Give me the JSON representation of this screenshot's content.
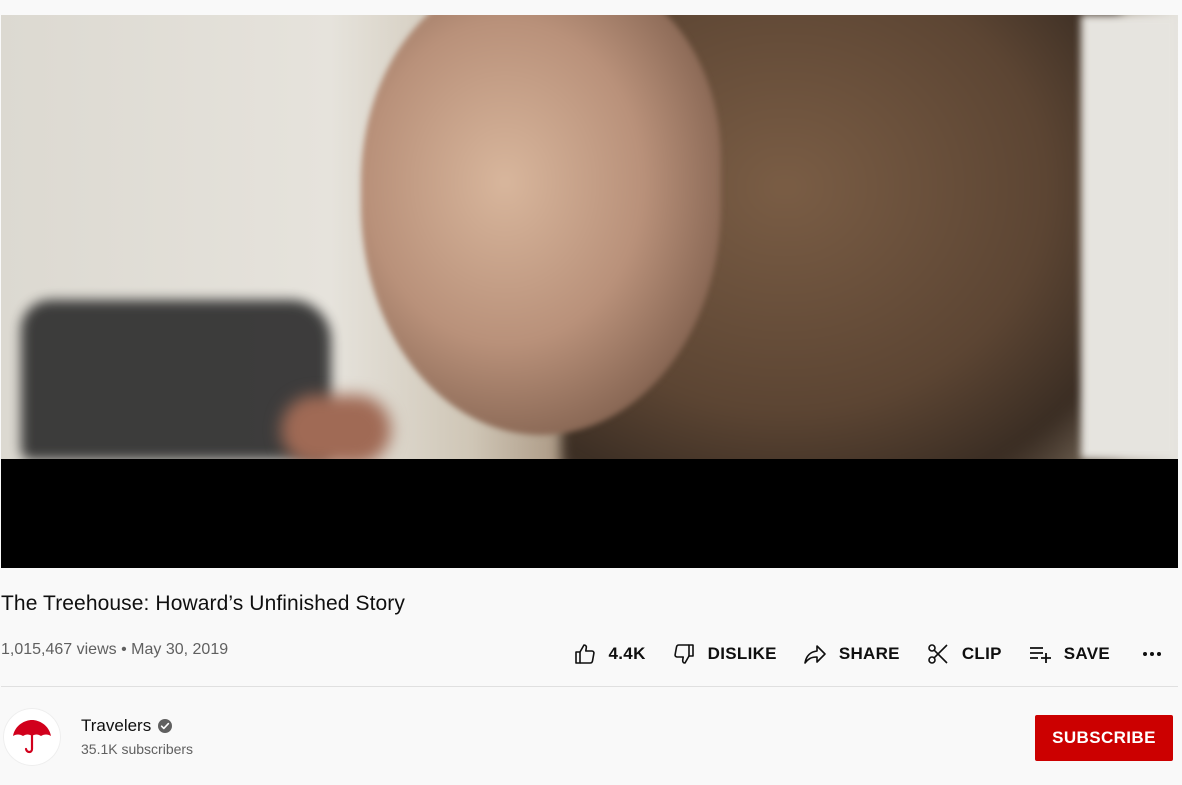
{
  "video": {
    "title": "The Treehouse: Howard’s Unfinished Story",
    "views": "1,015,467 views",
    "separator": "•",
    "date": "May 30, 2019"
  },
  "actions": {
    "like_label": "4.4K",
    "dislike_label": "DISLIKE",
    "share_label": "SHARE",
    "clip_label": "CLIP",
    "save_label": "SAVE"
  },
  "channel": {
    "name": "Travelers",
    "subscribers": "35.1K subscribers",
    "subscribe_label": "SUBSCRIBE"
  },
  "icons": {
    "like": "thumbs-up-icon",
    "dislike": "thumbs-down-icon",
    "share": "share-icon",
    "clip": "scissors-icon",
    "save": "playlist-add-icon",
    "more": "more-horizontal-icon",
    "verified": "verified-check-icon",
    "logo": "umbrella-icon"
  },
  "colors": {
    "subscribe_bg": "#cc0000",
    "logo_red": "#d1001c",
    "meta_text": "#606060"
  }
}
